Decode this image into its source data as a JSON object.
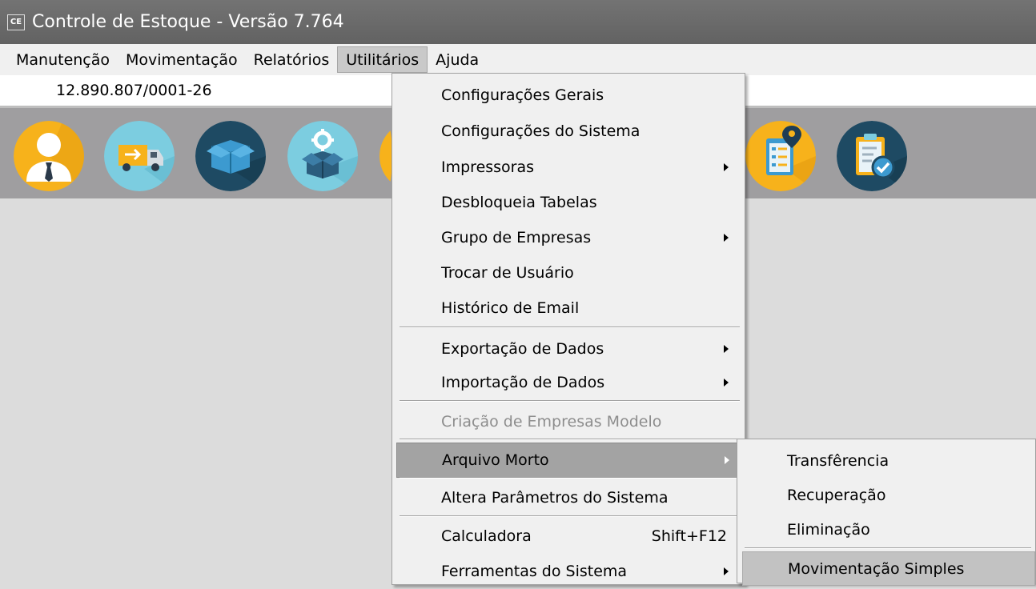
{
  "window": {
    "app_icon": "CE",
    "title": "Controle de Estoque - Versão 7.764"
  },
  "menubar": [
    {
      "label": "Manutenção",
      "active": false
    },
    {
      "label": "Movimentação",
      "active": false
    },
    {
      "label": "Relatórios",
      "active": false
    },
    {
      "label": "Utilitários",
      "active": true
    },
    {
      "label": "Ajuda",
      "active": false
    }
  ],
  "company": {
    "cnpj": "12.890.807/0001-26"
  },
  "toolbar": {
    "icons": [
      "user-icon",
      "delivery-truck-icon",
      "box-icon",
      "box-gear-icon",
      "partial-icon",
      "checklist-location-icon",
      "clipboard-check-icon"
    ]
  },
  "utilitarios_menu": {
    "items": [
      {
        "label": "Configurações Gerais",
        "submenu": false
      },
      {
        "label": "Configurações do Sistema",
        "submenu": false
      },
      {
        "label": "Impressoras",
        "submenu": true
      },
      {
        "label": "Desbloqueia Tabelas",
        "submenu": false
      },
      {
        "label": "Grupo de Empresas",
        "submenu": true
      },
      {
        "label": "Trocar de Usuário",
        "submenu": false
      },
      {
        "label": "Histórico de Email",
        "submenu": false
      },
      {
        "label": "Exportação de Dados",
        "submenu": true
      },
      {
        "label": "Importação de Dados",
        "submenu": true
      },
      {
        "label": "Criação de Empresas Modelo",
        "submenu": false,
        "disabled": true
      },
      {
        "label": "Arquivo Morto",
        "submenu": true,
        "highlighted": true
      },
      {
        "label": "Altera Parâmetros do Sistema",
        "submenu": false
      },
      {
        "label": "Calculadora",
        "shortcut": "Shift+F12",
        "submenu": false
      },
      {
        "label": "Ferramentas do Sistema",
        "submenu": true
      }
    ]
  },
  "arquivo_morto_menu": {
    "items": [
      {
        "label": "Transfêrencia"
      },
      {
        "label": "Recuperação"
      },
      {
        "label": "Eliminação"
      },
      {
        "label": "Movimentação Simples",
        "highlighted": true
      }
    ]
  },
  "colors": {
    "titlebar": "#6a6a6a",
    "toolbar": "#9f9ea0",
    "menu_bg": "#f0f0f0",
    "highlight": "#a3a3a3"
  }
}
